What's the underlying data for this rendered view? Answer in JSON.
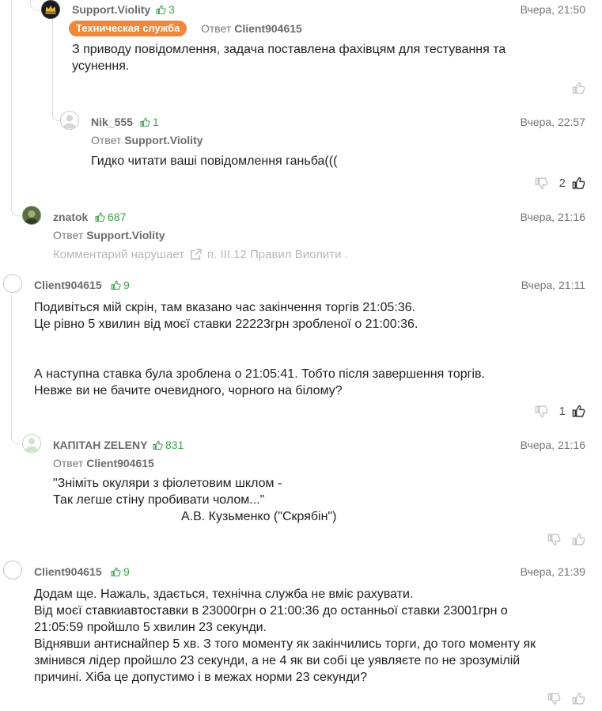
{
  "comments": [
    {
      "id": "c1",
      "username": "Support.Violity",
      "rating": "3",
      "time": "Вчера, 21:50",
      "badge": "Техническая служба",
      "reply_prefix": "Ответ",
      "reply_to": "Client904615",
      "text": "З приводу повідомлення, задача поставлена фахівцям для тестування та\nусунення.",
      "dislikes": "",
      "likes": ""
    },
    {
      "id": "c2",
      "username": "Nik_555",
      "rating": "1",
      "time": "Вчера, 22:57",
      "reply_prefix": "Ответ",
      "reply_to": "Support.Violity",
      "text": "Гидко читати ваші повідомлення ганьба(((",
      "dislikes": "",
      "likes": "2"
    },
    {
      "id": "c3",
      "username": "znatok",
      "rating": "687",
      "time": "Вчера, 21:16",
      "reply_prefix": "Ответ",
      "reply_to": "Support.Violity",
      "violation_prefix": "Комментарий нарушает",
      "violation_rule": "п. III.12 Правил Виолити ."
    },
    {
      "id": "c4",
      "username": "Client904615",
      "rating": "9",
      "time": "Вчера, 21:11",
      "text": "Подивіться мій скрін, там вказано час закінчення торгів 21:05:36.\nЦе рівно 5 хвилин від моєї ставки 22223грн зробленої о 21:00:36.\n\n\nА наступна ставка була зроблена о 21:05:41. Тобто після завершення торгів.\nНевже ви не бачите очевидного, чорного на білому?",
      "dislikes": "",
      "likes": "1"
    },
    {
      "id": "c5",
      "username": "КАПІТАН ZELENY",
      "rating": "831",
      "time": "Вчера, 21:16",
      "reply_prefix": "Ответ",
      "reply_to": "Client904615",
      "text_line1": "\"Зніміть окуляри з фіолетовим шклом -",
      "text_line2": "Так легше стіну пробивати чолом...\"",
      "text_line3": "А.В. Кузьменко (\"Скрябін\")",
      "dislikes": "",
      "likes": ""
    },
    {
      "id": "c6",
      "username": "Client904615",
      "rating": "9",
      "time": "Вчера, 21:39",
      "text": "Додам ще. Нажаль, здається, технічна служба не вміє рахувати.\nВід моєї ставкиавтоставки в 23000грн о 21:00:36 до останньої ставки 23001грн о\n21:05:59 пройшло 5 хвилин 23 секунди.\nВіднявши антиснайпер 5 хв. З того моменту як закінчились торги, до того моменту як\nзмінився лідер пройшло 23 секунди, а не 4 як ви собі це уявляєте по не зрозумілій\nпричині. Хіба це допустимо і в межах норми 23 секунди?",
      "dislikes": "",
      "likes": ""
    }
  ],
  "colors": {
    "rating_green": "#3fa34d",
    "badge_orange": "#f0873a",
    "thread_line": "#dcdcdc",
    "muted_text": "#757575"
  },
  "icons": {
    "rating": "thumb-up-icon",
    "like": "thumb-up-icon",
    "dislike": "thumb-down-icon",
    "violation": "external-link-icon",
    "support_avatar": "crown-icon",
    "default_avatar": "user-silhouette-icon"
  }
}
